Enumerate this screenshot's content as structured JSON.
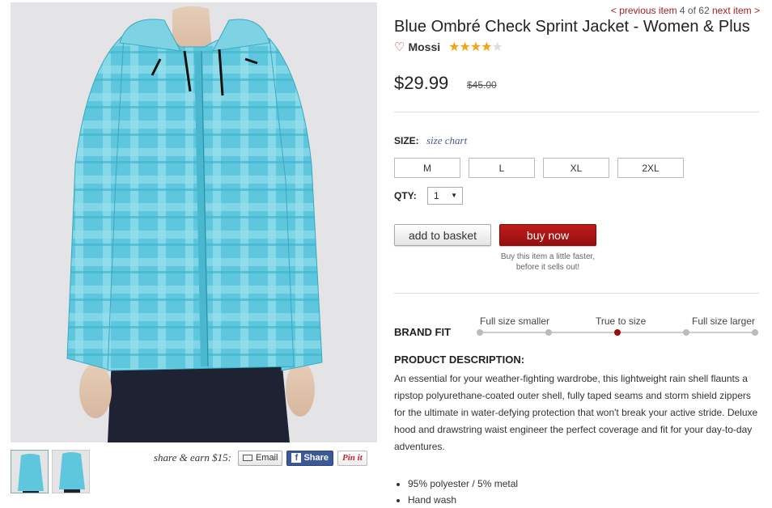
{
  "nav": {
    "prev": "< previous item",
    "position": "4 of 62",
    "next": "next item >"
  },
  "product": {
    "title": "Blue Ombré Check Sprint Jacket - Women & Plus",
    "brand": "Mossi",
    "rating": 4,
    "rating_max": 5,
    "price": "$29.99",
    "original_price": "$45.00"
  },
  "size": {
    "label": "SIZE:",
    "chart_link": "size chart",
    "options": [
      "M",
      "L",
      "XL",
      "2XL"
    ]
  },
  "qty": {
    "label": "QTY:",
    "value": "1"
  },
  "actions": {
    "add_to_basket": "add to basket",
    "buy_now": "buy now",
    "buy_note": "Buy this item a little faster, before it sells out!"
  },
  "brand_fit": {
    "label": "BRAND FIT",
    "scale": [
      "Full size smaller",
      "True to size",
      "Full size larger"
    ],
    "selected_position": 0.5
  },
  "description": {
    "heading": "PRODUCT DESCRIPTION:",
    "text": "An essential for your weather-fighting wardrobe, this lightweight rain shell flaunts a ripstop polyurethane-coated outer shell, fully taped seams and storm shield zippers for the ultimate in water-defying protection that won't break your active stride. Deluxe hood and drawstring waist engineer the perfect coverage and fit for your day-to-day adventures.",
    "bullets": [
      "95% polyester / 5% metal",
      "Hand wash"
    ]
  },
  "share": {
    "label": "share & earn $15:",
    "email": "Email",
    "facebook": "Share",
    "pinterest": "Pin it"
  },
  "icons": [
    "heart-icon",
    "star-icon",
    "envelope-icon",
    "facebook-icon",
    "dropdown-arrow-icon"
  ],
  "colors": {
    "accent": "#a12020",
    "buy_button": "#b01717",
    "star": "#f2a316",
    "facebook": "#3b5998",
    "jacket": "#5ec7dd"
  }
}
